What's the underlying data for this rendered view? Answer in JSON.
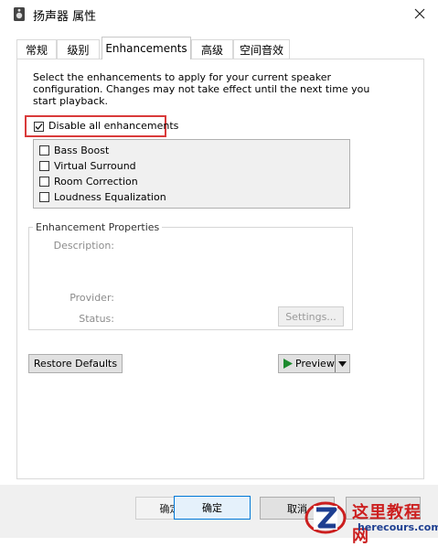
{
  "window": {
    "title": "扬声器 属性"
  },
  "tabs": [
    {
      "label": "常规"
    },
    {
      "label": "级别"
    },
    {
      "label": "Enhancements"
    },
    {
      "label": "高级"
    },
    {
      "label": "空间音效"
    }
  ],
  "enhancements_tab": {
    "instructions": "Select the enhancements to apply for your current speaker configuration. Changes may not take effect until the next time you start playback.",
    "disable_all": {
      "label": "Disable all enhancements",
      "checked": true
    },
    "items": [
      {
        "label": "Bass Boost",
        "checked": false
      },
      {
        "label": "Virtual Surround",
        "checked": false
      },
      {
        "label": "Room Correction",
        "checked": false
      },
      {
        "label": "Loudness Equalization",
        "checked": false
      }
    ],
    "properties": {
      "title": "Enhancement Properties",
      "description_label": "Description:",
      "provider_label": "Provider:",
      "status_label": "Status:",
      "settings_button": "Settings..."
    },
    "restore_defaults": "Restore Defaults",
    "preview": "Preview"
  },
  "footer": {
    "ok_ghost": "确定",
    "ok": "确定",
    "cancel": "取消"
  },
  "watermark": {
    "text_cn": "这里教程网",
    "text_url": "herecours.com"
  },
  "colors": {
    "highlight": "#d93a3a",
    "preview_play": "#1d8a2e",
    "accent": "#0078d7"
  }
}
